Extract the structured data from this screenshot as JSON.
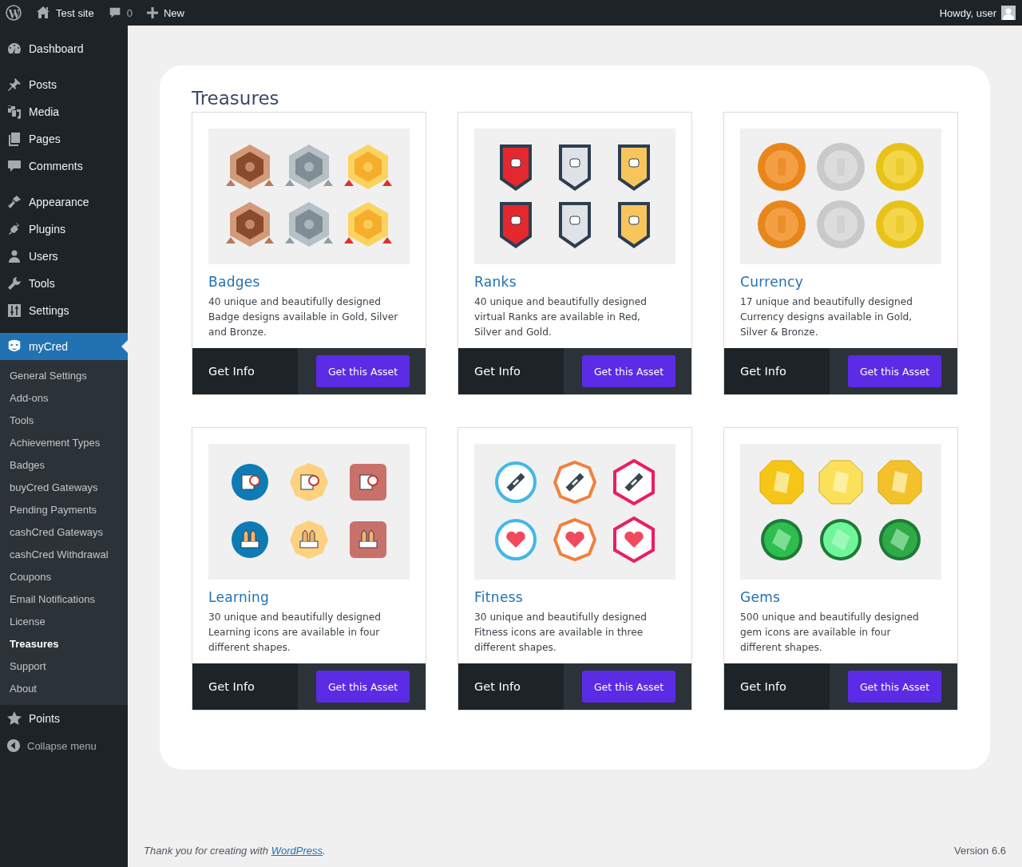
{
  "admin_bar": {
    "site": "Test site",
    "comments": "0",
    "new": "New",
    "greeting": "Howdy, user"
  },
  "sidebar": {
    "menu_groups": [
      [
        {
          "label": "Dashboard",
          "selected": false
        }
      ],
      [
        {
          "label": "Posts",
          "selected": false
        },
        {
          "label": "Media",
          "selected": false
        },
        {
          "label": "Pages",
          "selected": false
        },
        {
          "label": "Comments",
          "selected": false
        }
      ],
      [
        {
          "label": "Appearance",
          "selected": false
        },
        {
          "label": "Plugins",
          "selected": false
        },
        {
          "label": "Users",
          "selected": false
        },
        {
          "label": "Tools",
          "selected": false
        },
        {
          "label": "Settings",
          "selected": false
        }
      ],
      [
        {
          "label": "myCred",
          "selected": true,
          "children": [
            {
              "label": "General Settings",
              "selected": false
            },
            {
              "label": "Add-ons",
              "selected": false
            },
            {
              "label": "Tools",
              "selected": false
            },
            {
              "label": "Achievement Types",
              "selected": false
            },
            {
              "label": "Badges",
              "selected": false
            },
            {
              "label": "buyCred Gateways",
              "selected": false
            },
            {
              "label": "Pending Payments",
              "selected": false
            },
            {
              "label": "cashCred Gateways",
              "selected": false
            },
            {
              "label": "cashCred Withdrawal",
              "selected": false
            },
            {
              "label": "Coupons",
              "selected": false
            },
            {
              "label": "Email Notifications",
              "selected": false
            },
            {
              "label": "License",
              "selected": false
            },
            {
              "label": "Treasures",
              "selected": true
            },
            {
              "label": "Support",
              "selected": false
            },
            {
              "label": "About",
              "selected": false
            }
          ]
        },
        {
          "label": "Points",
          "selected": false
        }
      ]
    ],
    "collapse": "Collapse menu"
  },
  "page": {
    "title": "Treasures",
    "cards": [
      {
        "kind": "badges",
        "title": "Badges",
        "description": "40 unique and beautifully designed Badge designs available in Gold, Silver and Bronze.",
        "info": "Get Info",
        "button": "Get this Asset"
      },
      {
        "kind": "ranks",
        "title": "Ranks",
        "description": "40 unique and beautifully designed virtual Ranks are available in Red, Silver and Gold.",
        "info": "Get Info",
        "button": "Get this Asset"
      },
      {
        "kind": "coins",
        "title": "Currency",
        "description": "17 unique and beautifully designed Currency designs available in Gold, Silver & Bronze.",
        "info": "Get Info",
        "button": "Get this Asset"
      },
      {
        "kind": "learning",
        "title": "Learning",
        "description": "30 unique and beautifully designed Learning icons are available in four different shapes.",
        "info": "Get Info",
        "button": "Get this Asset"
      },
      {
        "kind": "fitness",
        "title": "Fitness",
        "description": "30 unique and beautifully designed Fitness icons are available in three different shapes.",
        "info": "Get Info",
        "button": "Get this Asset"
      },
      {
        "kind": "gems",
        "title": "Gems",
        "description": "500 unique and beautifully designed gem icons are available in four different shapes.",
        "info": "Get Info",
        "button": "Get this Asset"
      }
    ]
  },
  "footer": {
    "thanks": "Thank you for creating with",
    "link": "WordPress",
    "end": ".",
    "version": "Version 6.6"
  }
}
